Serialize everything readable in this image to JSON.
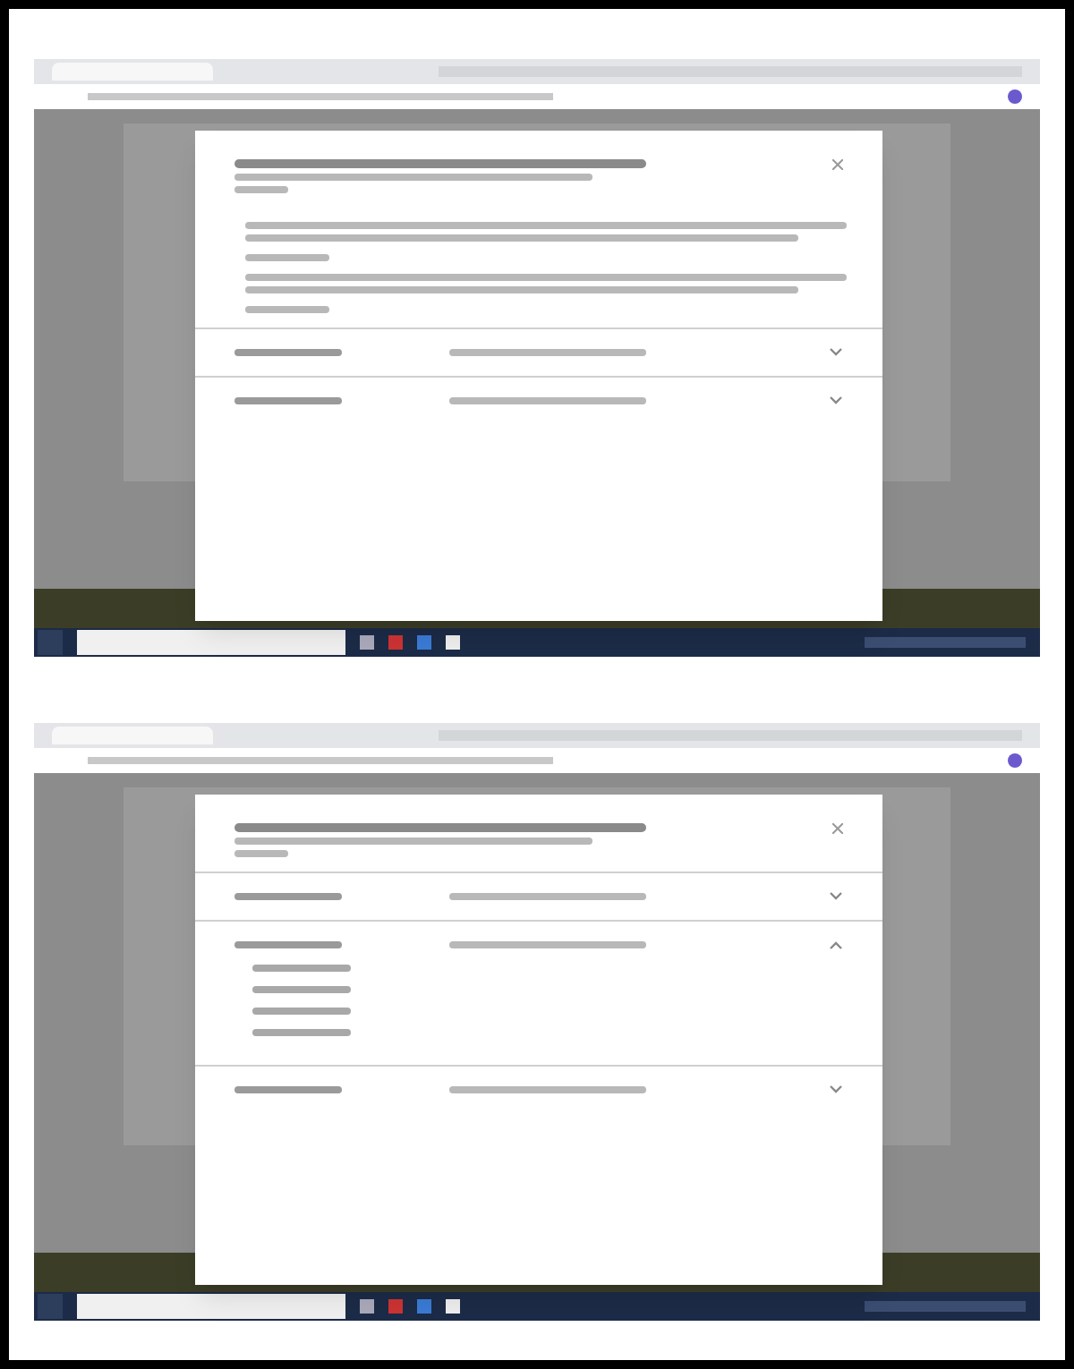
{
  "screenshots": [
    {
      "sections": [
        {
          "kind": "notes",
          "items": [
            {
              "kind": "paragraph"
            },
            {
              "kind": "short"
            },
            {
              "kind": "paragraph"
            },
            {
              "kind": "short"
            }
          ]
        },
        {
          "kind": "accordion",
          "expanded": false
        },
        {
          "kind": "accordion",
          "expanded": false
        }
      ]
    },
    {
      "sections": [
        {
          "kind": "accordion",
          "expanded": false
        },
        {
          "kind": "accordion",
          "expanded": true,
          "children": [
            {
              "kind": "link"
            },
            {
              "kind": "link"
            },
            {
              "kind": "link"
            },
            {
              "kind": "link"
            }
          ]
        },
        {
          "kind": "accordion",
          "expanded": false
        }
      ]
    }
  ]
}
